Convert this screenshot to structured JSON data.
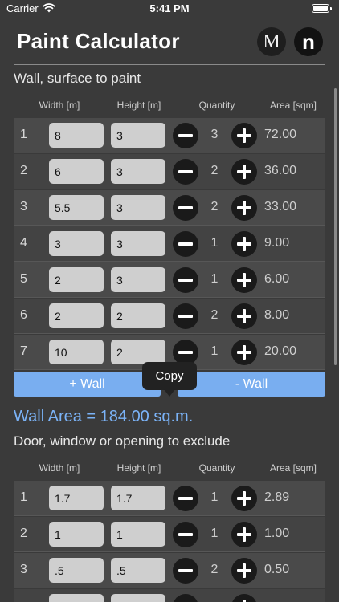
{
  "status_bar": {
    "carrier": "Carrier",
    "time": "5:41 PM"
  },
  "app": {
    "title": "Paint Calculator",
    "m_button": "M",
    "n_button": "n"
  },
  "walls": {
    "section_title": "Wall, surface to paint",
    "headers": {
      "width": "Width [m]",
      "height": "Height [m]",
      "quantity": "Quantity",
      "area": "Area [sqm]"
    },
    "rows": [
      {
        "index": "1",
        "width": "8",
        "height": "3",
        "quantity": "3",
        "area": "72.00"
      },
      {
        "index": "2",
        "width": "6",
        "height": "3",
        "quantity": "2",
        "area": "36.00"
      },
      {
        "index": "3",
        "width": "5.5",
        "height": "3",
        "quantity": "2",
        "area": "33.00"
      },
      {
        "index": "4",
        "width": "3",
        "height": "3",
        "quantity": "1",
        "area": "9.00"
      },
      {
        "index": "5",
        "width": "2",
        "height": "3",
        "quantity": "1",
        "area": "6.00"
      },
      {
        "index": "6",
        "width": "2",
        "height": "2",
        "quantity": "2",
        "area": "8.00"
      },
      {
        "index": "7",
        "width": "10",
        "height": "2",
        "quantity": "1",
        "area": "20.00"
      }
    ],
    "add_button": "+ Wall",
    "remove_button": "- Wall",
    "total": "Wall Area = 184.00 sq.m."
  },
  "tooltip": {
    "label": "Copy"
  },
  "openings": {
    "section_title": "Door, window or opening to exclude",
    "headers": {
      "width": "Width [m]",
      "height": "Height [m]",
      "quantity": "Quantity",
      "area": "Area [sqm]"
    },
    "rows": [
      {
        "index": "1",
        "width": "1.7",
        "height": "1.7",
        "quantity": "1",
        "area": "2.89"
      },
      {
        "index": "2",
        "width": "1",
        "height": "1",
        "quantity": "1",
        "area": "1.00"
      },
      {
        "index": "3",
        "width": ".5",
        "height": ".5",
        "quantity": "2",
        "area": "0.50"
      },
      {
        "index": "",
        "width": "",
        "height": "",
        "quantity": "",
        "area": ""
      }
    ]
  },
  "icons": {
    "wifi": "wifi-icon",
    "battery": "battery-icon",
    "minus": "minus-circle-icon",
    "plus": "plus-circle-icon"
  },
  "colors": {
    "background": "#3a3a3a",
    "accent": "#79aef0",
    "total_text": "#7bb3f7"
  }
}
